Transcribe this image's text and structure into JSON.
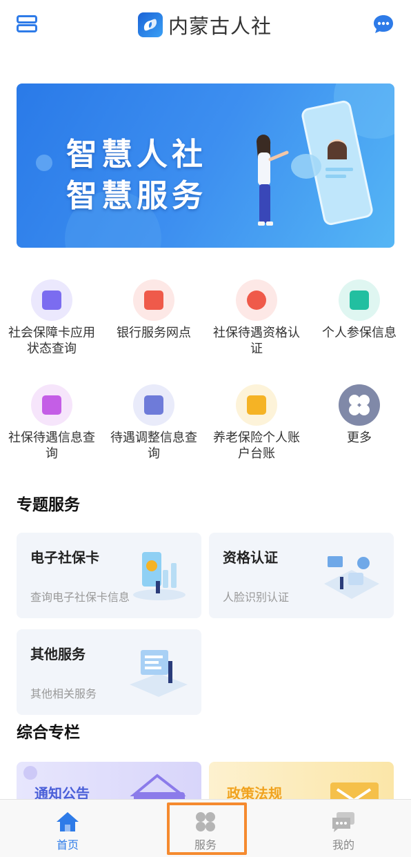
{
  "header": {
    "title": "内蒙古人社",
    "menu_icon": "menu-icon",
    "chat_icon": "chat-bubble-icon"
  },
  "banner": {
    "line1": "智慧人社",
    "line2": "智慧服务"
  },
  "services": [
    {
      "label": "社会保障卡应用状态查询",
      "icon": "id-card-search-icon",
      "color": "#7b6cf0",
      "bg": "#ebe8fd"
    },
    {
      "label": "银行服务网点",
      "icon": "bank-icon",
      "color": "#ef5a4a",
      "bg": "#fde8e6"
    },
    {
      "label": "社保待遇资格认证",
      "icon": "medal-icon",
      "color": "#ef5a4a",
      "bg": "#fde8e6"
    },
    {
      "label": "个人参保信息",
      "icon": "person-card-icon",
      "color": "#22bfa0",
      "bg": "#dff6f1"
    },
    {
      "label": "社保待遇信息查询",
      "icon": "person-list-icon",
      "color": "#c45ee6",
      "bg": "#f6e5fb"
    },
    {
      "label": "待遇调整信息查询",
      "icon": "yuan-adjust-icon",
      "color": "#6e7bd9",
      "bg": "#e9ebfa"
    },
    {
      "label": "养老保险个人账户台账",
      "icon": "ledger-icon",
      "color": "#f5b325",
      "bg": "#fdf3d9"
    },
    {
      "label": "更多",
      "icon": "more-grid-icon",
      "color": "#8089a8",
      "bg": "#8089a8"
    }
  ],
  "special": {
    "title": "专题服务",
    "cards": [
      {
        "title": "电子社保卡",
        "subtitle": "查询电子社保卡信息",
        "icon": "e-card-illustration"
      },
      {
        "title": "资格认证",
        "subtitle": "人脸识别认证",
        "icon": "face-auth-illustration"
      },
      {
        "title": "其他服务",
        "subtitle": "其他相关服务",
        "icon": "other-service-illustration"
      }
    ]
  },
  "columns": {
    "title": "综合专栏",
    "cards": [
      {
        "title": "通知公告",
        "color": "#4a5fd8"
      },
      {
        "title": "政策法规",
        "color": "#f0a21e"
      }
    ]
  },
  "tabbar": {
    "items": [
      {
        "label": "首页",
        "icon": "home-icon",
        "active": true
      },
      {
        "label": "服务",
        "icon": "services-grid-icon",
        "active": false
      },
      {
        "label": "我的",
        "icon": "chat-profile-icon",
        "active": false
      }
    ]
  },
  "colors": {
    "accent": "#2e7be8",
    "highlight": "#f58a2f"
  }
}
